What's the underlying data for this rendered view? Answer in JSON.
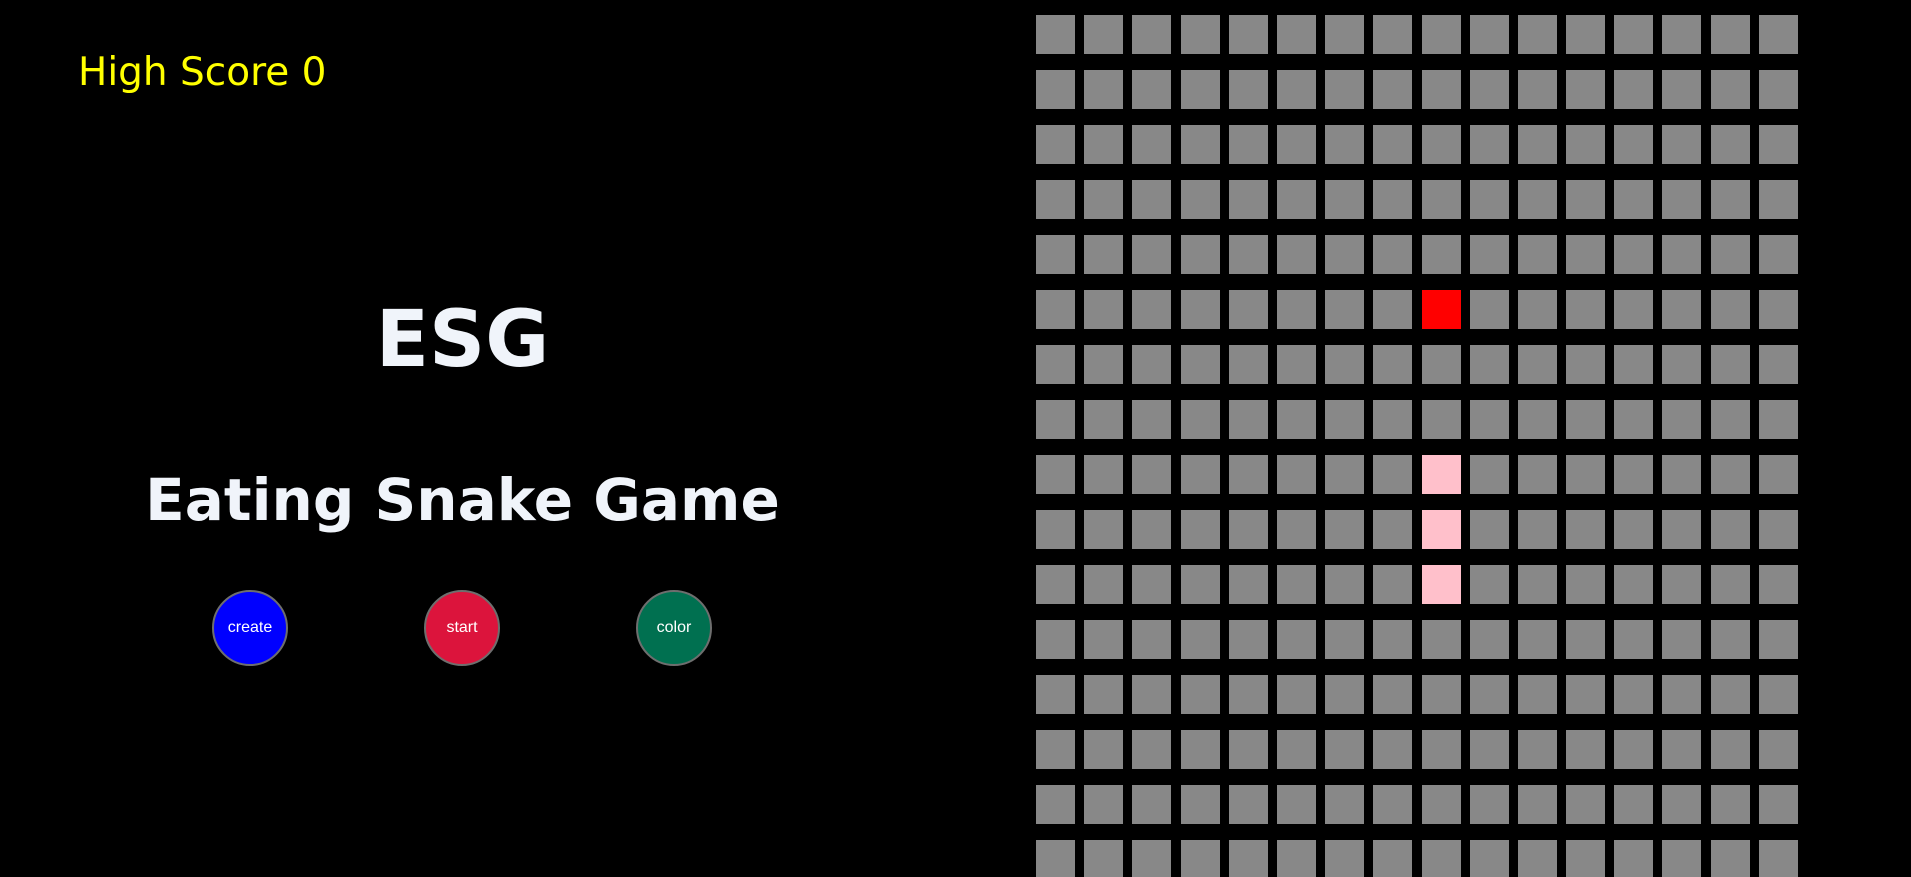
{
  "header": {
    "high_score_label": "High Score 0"
  },
  "title": {
    "short": "ESG",
    "full": "Eating Snake Game"
  },
  "buttons": [
    {
      "label": "create",
      "color": "#0000ff",
      "name": "create-button"
    },
    {
      "label": "start",
      "color": "#dc143c",
      "name": "start-button"
    },
    {
      "label": "color",
      "color": "#007050",
      "name": "color-button"
    }
  ],
  "board": {
    "columns": 16,
    "visible_rows": 16,
    "cell_color": "#888888",
    "food_color": "#ff0000",
    "snake_color": "#ffc0cb",
    "food": {
      "row": 5,
      "col": 8
    },
    "snake": [
      {
        "row": 8,
        "col": 8
      },
      {
        "row": 9,
        "col": 8
      },
      {
        "row": 10,
        "col": 8
      }
    ]
  }
}
